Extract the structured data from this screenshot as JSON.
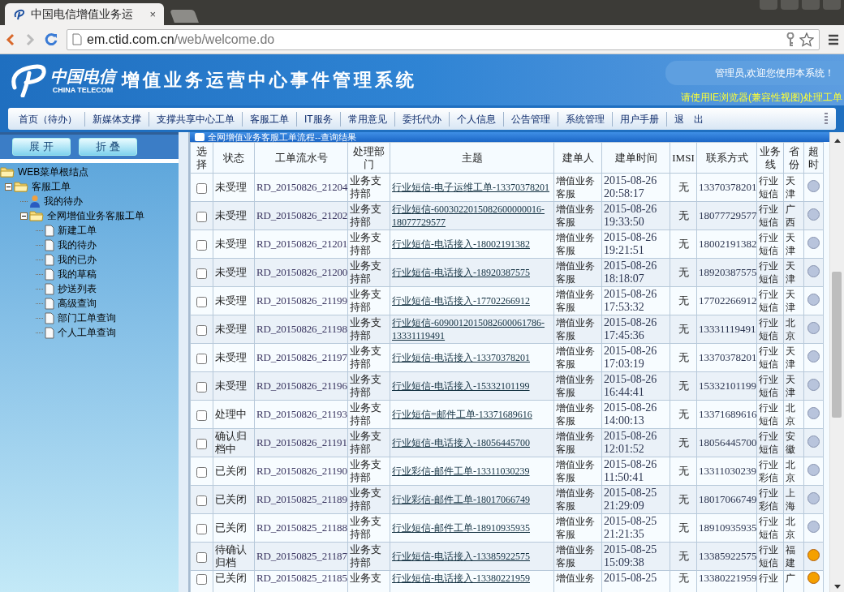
{
  "browser": {
    "tab_title": "中国电信增值业务运",
    "url_host": "em.ctid.com.cn",
    "url_path": "/web/welcome.do",
    "tab_close": "×"
  },
  "header": {
    "logo_cn": "中国电信",
    "logo_en": "CHINA TELECOM",
    "system_title": "增值业务运营中心事件管理系统",
    "welcome": "管理员,欢迎您使用本系统！",
    "notice": "请使用IE浏览器(兼容性视图)处理工单"
  },
  "nav": [
    "首页（待办）",
    "新媒体支撑",
    "支撑共享中心工单",
    "客服工单",
    "IT服务",
    "常用意见",
    "委托代办",
    "个人信息",
    "公告管理",
    "系统管理",
    "用户手册",
    "退　出"
  ],
  "sidebar": {
    "buttons": [
      "展 开",
      "折 叠"
    ],
    "tree": [
      {
        "label": "WEB菜单根结点",
        "kind": "folder",
        "expanded": true,
        "children": [
          {
            "label": "客服工单",
            "kind": "folder",
            "expanded": true,
            "children": [
              {
                "label": "我的待办",
                "kind": "person"
              },
              {
                "label": "全网增值业务客服工单",
                "kind": "folder",
                "expanded": true,
                "children": [
                  {
                    "label": "新建工单",
                    "kind": "page"
                  },
                  {
                    "label": "我的待办",
                    "kind": "page"
                  },
                  {
                    "label": "我的已办",
                    "kind": "page"
                  },
                  {
                    "label": "我的草稿",
                    "kind": "page"
                  },
                  {
                    "label": "抄送列表",
                    "kind": "page"
                  },
                  {
                    "label": "高级查询",
                    "kind": "page"
                  },
                  {
                    "label": "部门工单查询",
                    "kind": "page"
                  },
                  {
                    "label": "个人工单查询",
                    "kind": "page"
                  }
                ]
              }
            ]
          }
        ]
      }
    ]
  },
  "table": {
    "title": "全网增值业务客服工单流程--查询结果",
    "columns": [
      "选择",
      "状态",
      "工单流水号",
      "处理部门",
      "主题",
      "建单人",
      "建单时间",
      "IMSI",
      "联系方式",
      "业务线",
      "省份",
      "超时"
    ],
    "rows": [
      {
        "checked": false,
        "status": "未受理",
        "id": "RD_20150826_21204",
        "dept": "业务支持部",
        "subject": "行业短信-电子运维工单-13370378201",
        "creator": "增值业务客服",
        "time": "2015-08-26 20:58:17",
        "imsi": "无",
        "contact": "13370378201",
        "line": "行业短信",
        "province": "天津",
        "overdue": false
      },
      {
        "checked": false,
        "status": "未受理",
        "id": "RD_20150826_21202",
        "dept": "业务支持部",
        "subject": "行业短信-6003022015082600000016-18077729577",
        "creator": "增值业务客服",
        "time": "2015-08-26 19:33:50",
        "imsi": "无",
        "contact": "18077729577",
        "line": "行业短信",
        "province": "广西",
        "overdue": false
      },
      {
        "checked": false,
        "status": "未受理",
        "id": "RD_20150826_21201",
        "dept": "业务支持部",
        "subject": "行业短信-电话接入-18002191382",
        "creator": "增值业务客服",
        "time": "2015-08-26 19:21:51",
        "imsi": "无",
        "contact": "18002191382",
        "line": "行业短信",
        "province": "天津",
        "overdue": false
      },
      {
        "checked": false,
        "status": "未受理",
        "id": "RD_20150826_21200",
        "dept": "业务支持部",
        "subject": "行业短信-电话接入-18920387575",
        "creator": "增值业务客服",
        "time": "2015-08-26 18:18:07",
        "imsi": "无",
        "contact": "18920387575",
        "line": "行业短信",
        "province": "天津",
        "overdue": false
      },
      {
        "checked": false,
        "status": "未受理",
        "id": "RD_20150826_21199",
        "dept": "业务支持部",
        "subject": "行业短信-电话接入-17702266912",
        "creator": "增值业务客服",
        "time": "2015-08-26 17:53:32",
        "imsi": "无",
        "contact": "17702266912",
        "line": "行业短信",
        "province": "天津",
        "overdue": false
      },
      {
        "checked": false,
        "status": "未受理",
        "id": "RD_20150826_21198",
        "dept": "业务支持部",
        "subject": "行业短信-6090012015082600061786-13331119491",
        "creator": "增值业务客服",
        "time": "2015-08-26 17:45:36",
        "imsi": "无",
        "contact": "13331119491",
        "line": "行业短信",
        "province": "北京",
        "overdue": false
      },
      {
        "checked": false,
        "status": "未受理",
        "id": "RD_20150826_21197",
        "dept": "业务支持部",
        "subject": "行业短信-电话接入-13370378201",
        "creator": "增值业务客服",
        "time": "2015-08-26 17:03:19",
        "imsi": "无",
        "contact": "13370378201",
        "line": "行业短信",
        "province": "天津",
        "overdue": false
      },
      {
        "checked": false,
        "status": "未受理",
        "id": "RD_20150826_21196",
        "dept": "业务支持部",
        "subject": "行业短信-电话接入-15332101199",
        "creator": "增值业务客服",
        "time": "2015-08-26 16:44:41",
        "imsi": "无",
        "contact": "15332101199",
        "line": "行业短信",
        "province": "天津",
        "overdue": false
      },
      {
        "checked": false,
        "status": "处理中",
        "id": "RD_20150826_21193",
        "dept": "业务支持部",
        "subject": "行业短信=邮件工单-13371689616",
        "creator": "增值业务客服",
        "time": "2015-08-26 14:00:13",
        "imsi": "无",
        "contact": "13371689616",
        "line": "行业短信",
        "province": "北京",
        "overdue": false
      },
      {
        "checked": false,
        "status": "确认归档中",
        "id": "RD_20150826_21191",
        "dept": "业务支持部",
        "subject": "行业短信-电话接入-18056445700",
        "creator": "增值业务客服",
        "time": "2015-08-26 12:01:52",
        "imsi": "无",
        "contact": "18056445700",
        "line": "行业短信",
        "province": "安徽",
        "overdue": false
      },
      {
        "checked": false,
        "status": "已关闭",
        "id": "RD_20150826_21190",
        "dept": "业务支持部",
        "subject": "行业彩信-邮件工单-13311030239",
        "creator": "增值业务客服",
        "time": "2015-08-26 11:50:41",
        "imsi": "无",
        "contact": "13311030239",
        "line": "行业彩信",
        "province": "北京",
        "overdue": false
      },
      {
        "checked": false,
        "status": "已关闭",
        "id": "RD_20150825_21189",
        "dept": "业务支持部",
        "subject": "行业彩信-邮件工单-18017066749",
        "creator": "增值业务客服",
        "time": "2015-08-25 21:29:09",
        "imsi": "无",
        "contact": "18017066749",
        "line": "行业彩信",
        "province": "上海",
        "overdue": false
      },
      {
        "checked": false,
        "status": "已关闭",
        "id": "RD_20150825_21188",
        "dept": "业务支持部",
        "subject": "行业短信-邮件工单-18910935935",
        "creator": "增值业务客服",
        "time": "2015-08-25 21:21:35",
        "imsi": "无",
        "contact": "18910935935",
        "line": "行业短信",
        "province": "北京",
        "overdue": false
      },
      {
        "checked": false,
        "status": "待确认归档",
        "id": "RD_20150825_21187",
        "dept": "业务支持部",
        "subject": "行业短信-电话接入-13385922575",
        "creator": "增值业务客服",
        "time": "2015-08-25 15:09:38",
        "imsi": "无",
        "contact": "13385922575",
        "line": "行业短信",
        "province": "福建",
        "overdue": true
      },
      {
        "checked": false,
        "status": "已关闭",
        "id": "RD_20150825_21185",
        "dept": "业务支",
        "subject": "行业短信-电话接入-13380221959",
        "creator": "增值业务",
        "time": "2015-08-25",
        "imsi": "无",
        "contact": "13380221959",
        "line": "行业",
        "province": "广",
        "overdue": true
      }
    ]
  }
}
